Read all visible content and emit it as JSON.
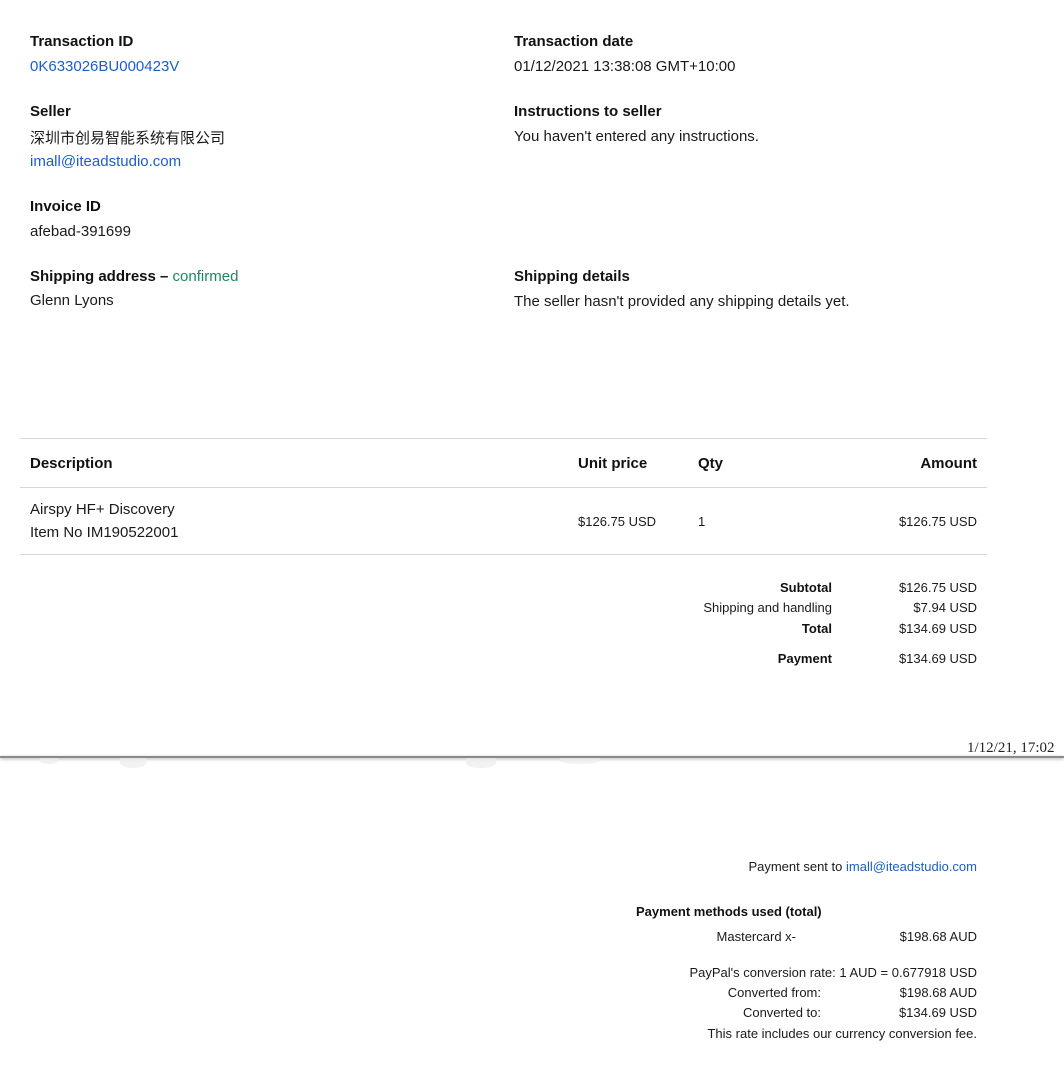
{
  "transaction": {
    "id_label": "Transaction ID",
    "id_value": "0K633026BU000423V",
    "date_label": "Transaction date",
    "date_value": "01/12/2021 13:38:08 GMT+10:00"
  },
  "seller": {
    "label": "Seller",
    "name": "深圳市创易智能系统有限公司",
    "email": "imall@iteadstudio.com"
  },
  "instructions": {
    "label": "Instructions to seller",
    "value": "You haven't entered any instructions."
  },
  "invoice": {
    "label": "Invoice ID",
    "value": "afebad-391699"
  },
  "shipping_address": {
    "label": "Shipping address –",
    "status": "confirmed",
    "name": "Glenn Lyons"
  },
  "shipping_details": {
    "label": "Shipping details",
    "value": "The seller hasn't provided any shipping details yet."
  },
  "items_table": {
    "headers": {
      "description": "Description",
      "unit_price": "Unit price",
      "qty": "Qty",
      "amount": "Amount"
    },
    "rows": [
      {
        "description": "Airspy HF+ Discovery",
        "item_no": "Item No IM190522001",
        "unit_price": "$126.75 USD",
        "qty": "1",
        "amount": "$126.75 USD"
      }
    ]
  },
  "totals": {
    "subtotal_label": "Subtotal",
    "subtotal_value": "$126.75 USD",
    "shipping_label": "Shipping and handling",
    "shipping_value": "$7.94 USD",
    "total_label": "Total",
    "total_value": "$134.69 USD",
    "payment_label": "Payment",
    "payment_value": "$134.69 USD"
  },
  "print_stamp": "1/12/21, 17:02",
  "payment_sent": {
    "label": "Payment sent to",
    "email": "imall@iteadstudio.com"
  },
  "payment_methods": {
    "title": "Payment methods used (total)",
    "method": "Mastercard x-",
    "method_value": "$198.68 AUD"
  },
  "conversion": {
    "rate": "PayPal's conversion rate: 1 AUD = 0.677918 USD",
    "from_label": "Converted from:",
    "from_value": "$198.68 AUD",
    "to_label": "Converted to:",
    "to_value": "$134.69 USD",
    "note": "This rate includes our currency conversion fee."
  },
  "colors": {
    "link": "#1a5fc8",
    "confirmed": "#1a8a5c",
    "divider": "#d6d6d6"
  }
}
